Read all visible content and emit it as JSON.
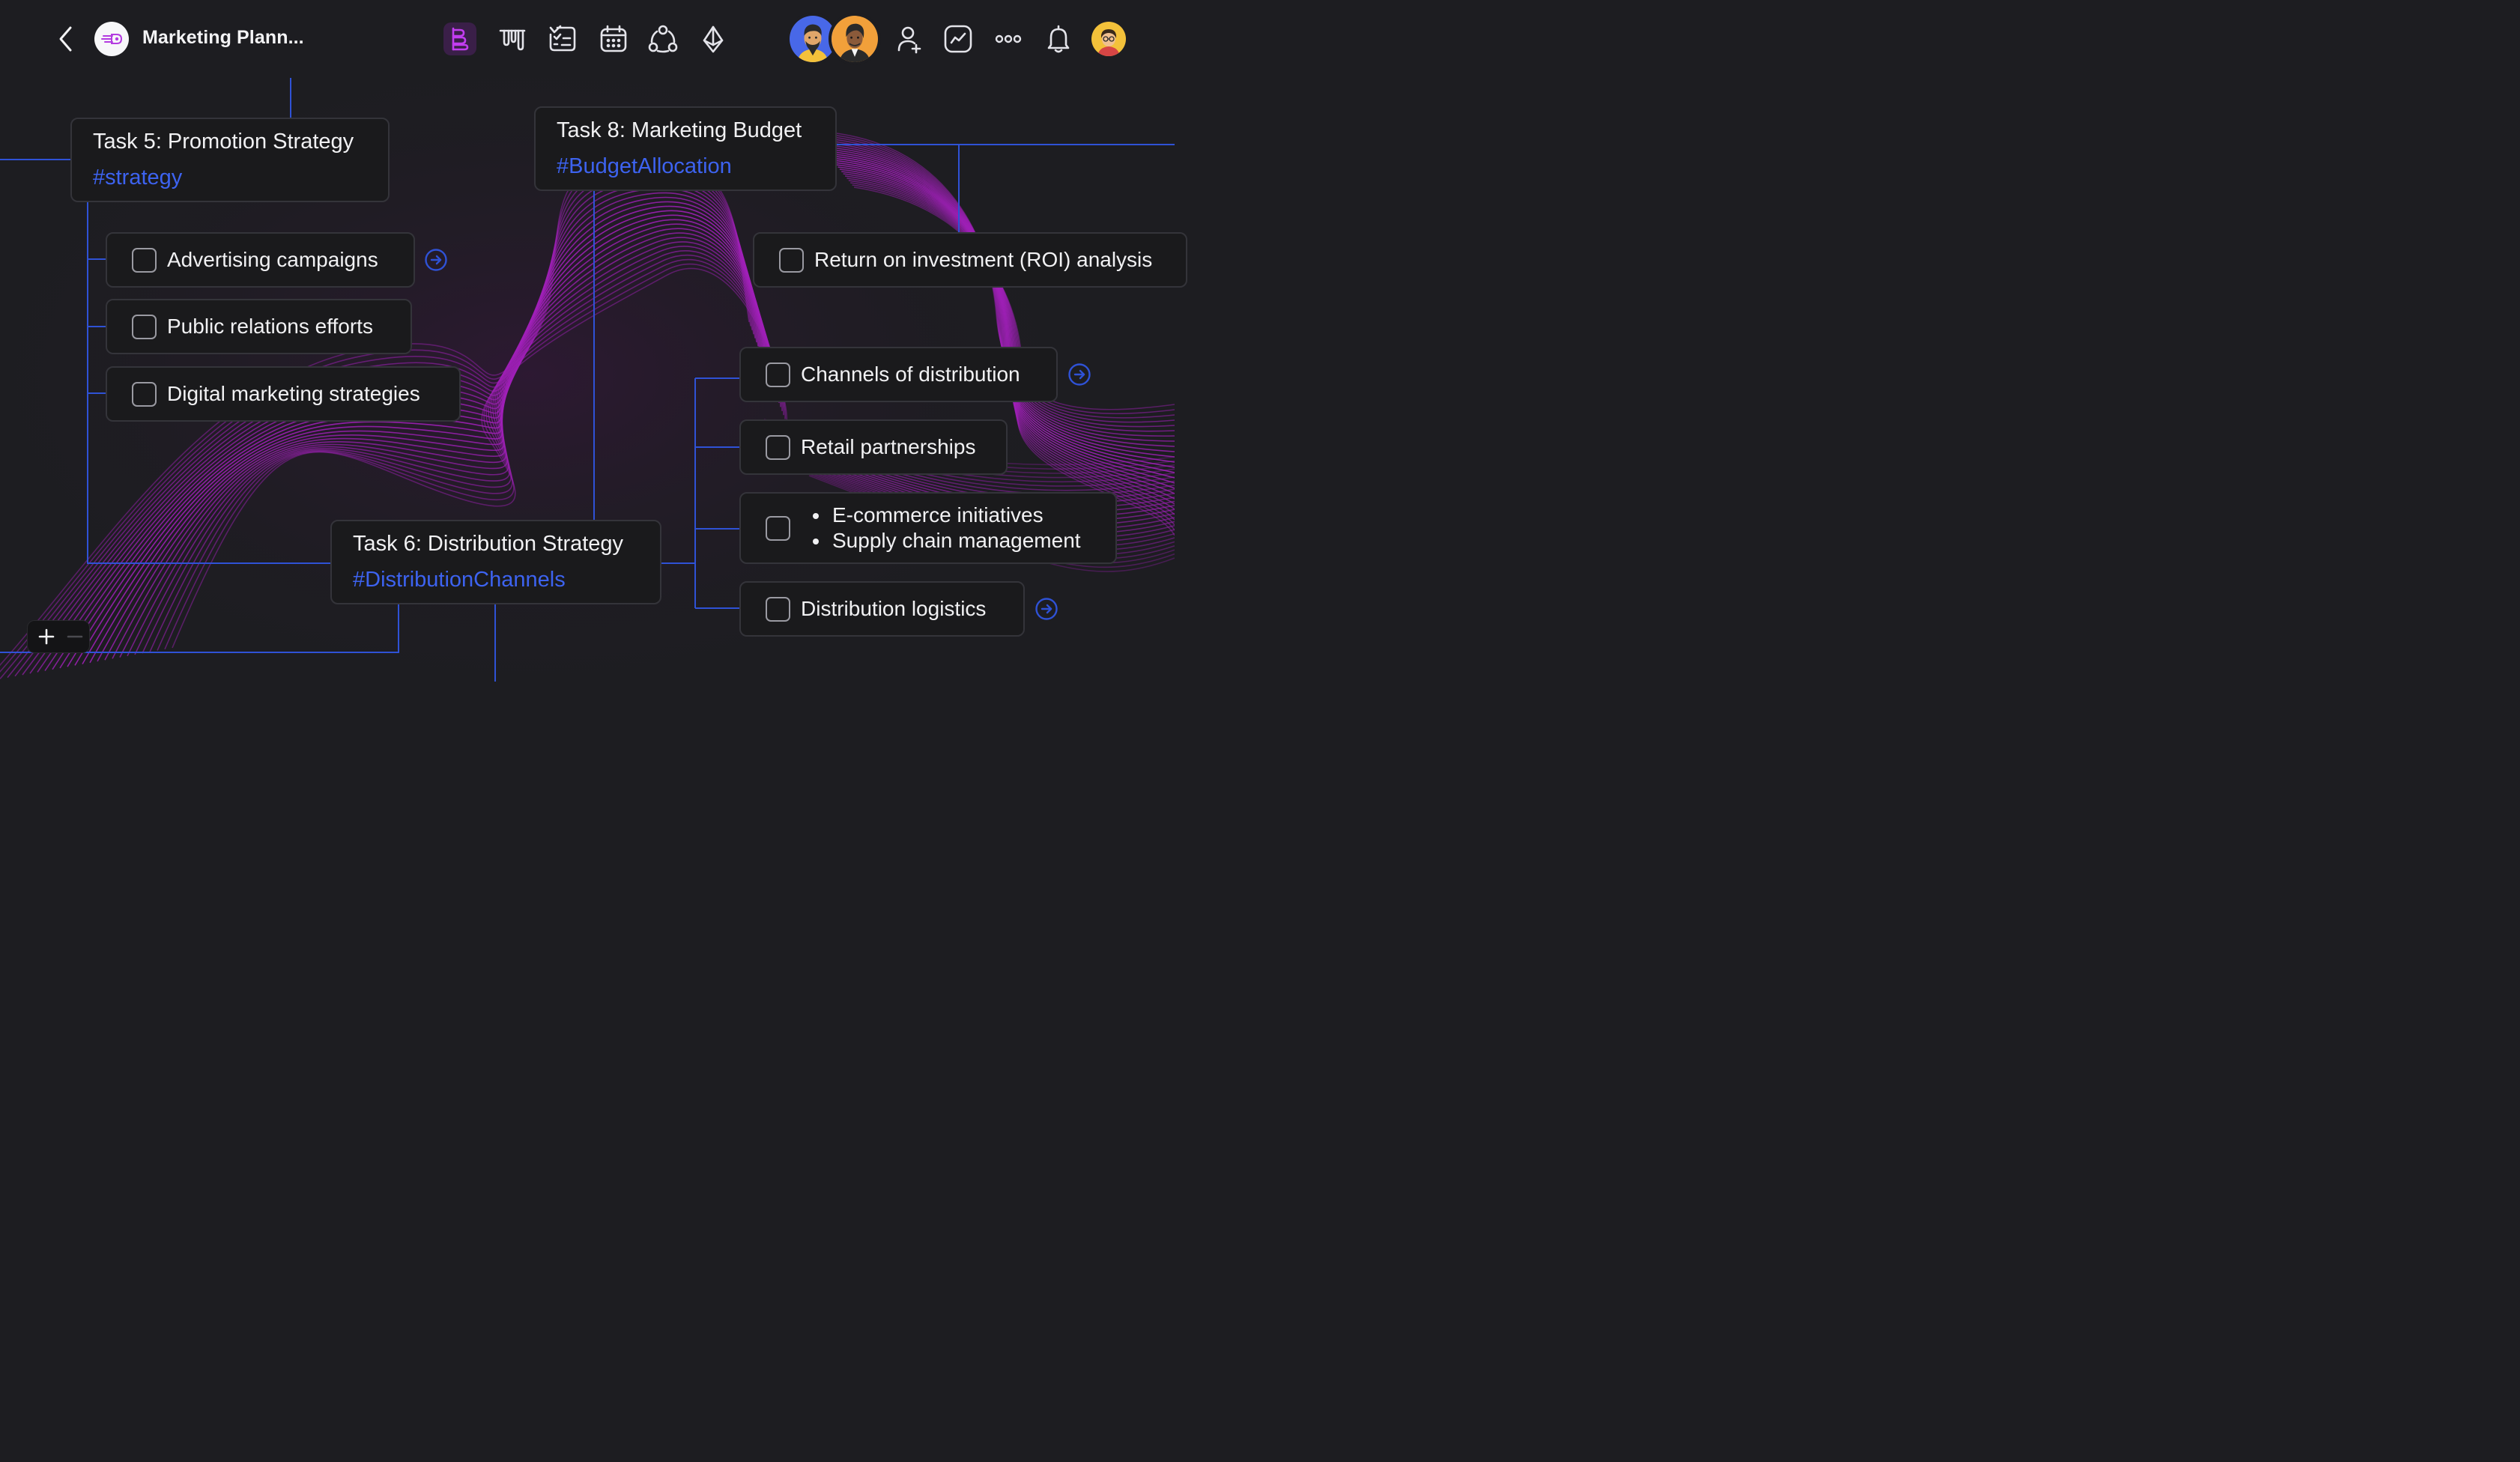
{
  "header": {
    "title": "Marketing Plann...",
    "back_icon": "chevron-left-icon",
    "app_icon": "rocket-logo-icon",
    "toolbar": [
      {
        "name": "mindmap-view-icon",
        "active": true
      },
      {
        "name": "kanban-view-icon",
        "active": false
      },
      {
        "name": "checklist-view-icon",
        "active": false
      },
      {
        "name": "calendar-view-icon",
        "active": false
      },
      {
        "name": "network-view-icon",
        "active": false
      },
      {
        "name": "ethereum-icon",
        "active": false
      }
    ],
    "right_icons": [
      "add-user-icon",
      "analytics-icon",
      "more-icon",
      "bell-icon"
    ]
  },
  "canvas": {
    "tasks": [
      {
        "title": "Task 5: Promotion Strategy",
        "tag": "#strategy"
      },
      {
        "title": "Task 8: Marketing Budget",
        "tag": "#BudgetAllocation"
      },
      {
        "title": "Task 6: Distribution Strategy",
        "tag": "#DistributionChannels"
      }
    ],
    "task5_items": [
      "Advertising campaigns",
      "Public relations efforts",
      "Digital marketing strategies"
    ],
    "task8_items": [
      "Return on investment (ROI) analysis"
    ],
    "task6_items": [
      "Channels of distribution",
      "Retail partnerships",
      "Distribution logistics"
    ],
    "task6_bullets": [
      "E-commerce initiatives",
      "Supply chain management"
    ]
  },
  "colors": {
    "background": "#1d1d21",
    "connector": "#2f52d6",
    "tag": "#3d63f0",
    "wave": "#a020b8",
    "accent": "#b33be0"
  }
}
